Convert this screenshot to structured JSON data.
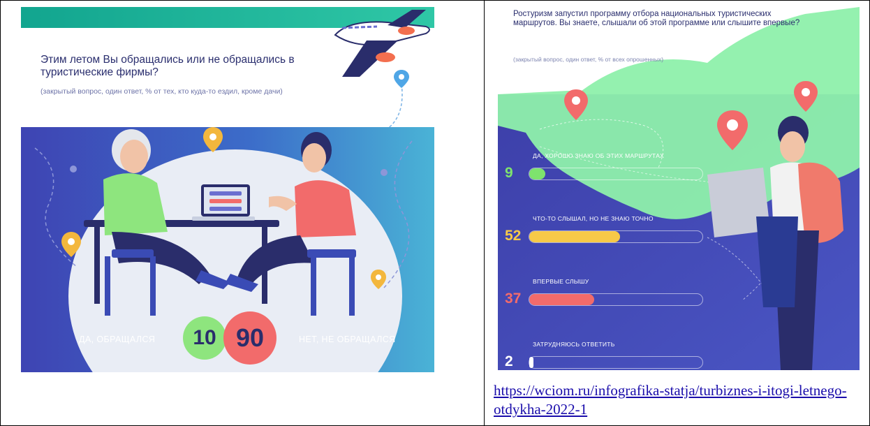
{
  "colors": {
    "teal": "#12a58f",
    "green_circle": "#8ee57e",
    "red_circle": "#f26b6b",
    "yellow_bar": "#f7c948",
    "pink_bar": "#f26b6b",
    "green_bar": "#7ee36d",
    "white_bar": "#ffffff"
  },
  "icons": [
    "airplane-icon",
    "location-pin-icon"
  ],
  "left_infographic": {
    "title": "Этим летом Вы обращались или не обращались в туристические фирмы?",
    "note": "(закрытый вопрос, один ответ, % от тех, кто куда-то ездил, кроме дачи)",
    "chart_data": {
      "type": "bar",
      "categories": [
        "ДА, ОБРАЩАЛСЯ",
        "НЕТ, НЕ ОБРАЩАЛСЯ"
      ],
      "values": [
        10,
        90
      ]
    }
  },
  "right_infographic": {
    "title": "Ростуризм запустил программу отбора национальных туристических маршрутов. Вы знаете, слышали об этой программе или слышите впервые?",
    "note": "(закрытый вопрос, один ответ, % от всех опрошенных)",
    "chart_data": {
      "type": "bar",
      "categories": [
        "ДА, ХОРОШО ЗНАЮ ОБ ЭТИХ МАРШРУТАХ",
        "ЧТО-ТО СЛЫШАЛ, НО НЕ ЗНАЮ ТОЧНО",
        "ВПЕРВЫЕ СЛЫШУ",
        "ЗАТРУДНЯЮСЬ ОТВЕТИТЬ"
      ],
      "values": [
        9,
        52,
        37,
        2
      ],
      "ylim": [
        0,
        100
      ]
    }
  },
  "source": {
    "url": "https://wciom.ru/infografika-statja/turbiznes-i-itogi-letnego-otdykha-2022-1"
  }
}
